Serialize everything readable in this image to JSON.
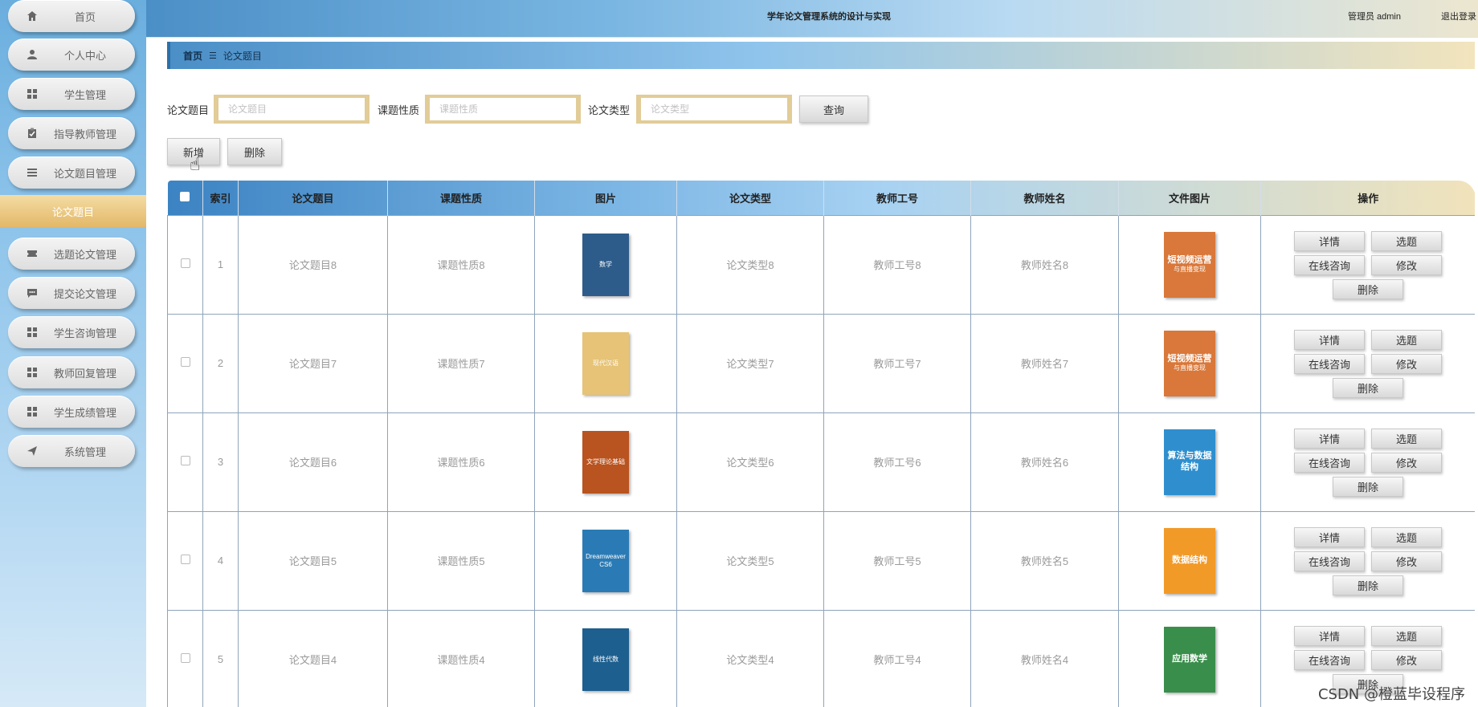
{
  "app": {
    "title": "学年论文管理系统的设计与实现",
    "user": "管理员 admin",
    "logout": "退出登录"
  },
  "sidebar": {
    "items": [
      {
        "label": "首页",
        "icon": "home-icon"
      },
      {
        "label": "个人中心",
        "icon": "user-icon"
      },
      {
        "label": "学生管理",
        "icon": "grid-icon"
      },
      {
        "label": "指导教师管理",
        "icon": "clipboard-icon"
      },
      {
        "label": "论文题目管理",
        "icon": "list-icon"
      },
      {
        "label": "选题论文管理",
        "icon": "ticket-icon"
      },
      {
        "label": "提交论文管理",
        "icon": "chat-icon"
      },
      {
        "label": "学生咨询管理",
        "icon": "grid-icon"
      },
      {
        "label": "教师回复管理",
        "icon": "grid-icon"
      },
      {
        "label": "学生成绩管理",
        "icon": "grid-icon"
      },
      {
        "label": "系统管理",
        "icon": "send-icon"
      }
    ],
    "active_sub": "论文题目"
  },
  "breadcrumb": {
    "home": "首页",
    "current": "论文题目"
  },
  "search": {
    "title_label": "论文题目",
    "title_placeholder": "论文题目",
    "nature_label": "课题性质",
    "nature_placeholder": "课题性质",
    "type_label": "论文类型",
    "type_placeholder": "论文类型",
    "query_button": "查询"
  },
  "actions": {
    "add": "新增",
    "delete": "删除"
  },
  "table": {
    "headers": {
      "index": "索引",
      "title": "论文题目",
      "nature": "课题性质",
      "image": "图片",
      "type": "论文类型",
      "teacher_no": "教师工号",
      "teacher_name": "教师姓名",
      "file_image": "文件图片",
      "ops": "操作"
    },
    "ops": {
      "detail": "详情",
      "select": "选题",
      "consult": "在线咨询",
      "edit": "修改",
      "delete": "删除"
    },
    "rows": [
      {
        "index": "1",
        "title": "论文题目8",
        "nature": "课题性质8",
        "type": "论文类型8",
        "teacher_no": "教师工号8",
        "teacher_name": "教师姓名8",
        "cover": {
          "text": "数学",
          "color": "#2d5c8a"
        },
        "file": {
          "text": "短视频运营",
          "sub": "与直播变现",
          "color": "#d9783a"
        }
      },
      {
        "index": "2",
        "title": "论文题目7",
        "nature": "课题性质7",
        "type": "论文类型7",
        "teacher_no": "教师工号7",
        "teacher_name": "教师姓名7",
        "cover": {
          "text": "现代汉语",
          "color": "#e6c376"
        },
        "file": {
          "text": "短视频运营",
          "sub": "与直播变现",
          "color": "#d9783a"
        }
      },
      {
        "index": "3",
        "title": "论文题目6",
        "nature": "课题性质6",
        "type": "论文类型6",
        "teacher_no": "教师工号6",
        "teacher_name": "教师姓名6",
        "cover": {
          "text": "文学理论基础",
          "color": "#b9531f"
        },
        "file": {
          "text": "算法与数据结构",
          "sub": "",
          "color": "#2f8fce"
        }
      },
      {
        "index": "4",
        "title": "论文题目5",
        "nature": "课题性质5",
        "type": "论文类型5",
        "teacher_no": "教师工号5",
        "teacher_name": "教师姓名5",
        "cover": {
          "text": "Dreamweaver CS6",
          "color": "#2a7bb5"
        },
        "file": {
          "text": "数据结构",
          "sub": "",
          "color": "#f29a28"
        }
      },
      {
        "index": "5",
        "title": "论文题目4",
        "nature": "课题性质4",
        "type": "论文类型4",
        "teacher_no": "教师工号4",
        "teacher_name": "教师姓名4",
        "cover": {
          "text": "线性代数",
          "color": "#1d5f8f"
        },
        "file": {
          "text": "应用数学",
          "sub": "",
          "color": "#3a8e4b"
        }
      }
    ]
  },
  "watermark": "CSDN @橙蓝毕设程序"
}
